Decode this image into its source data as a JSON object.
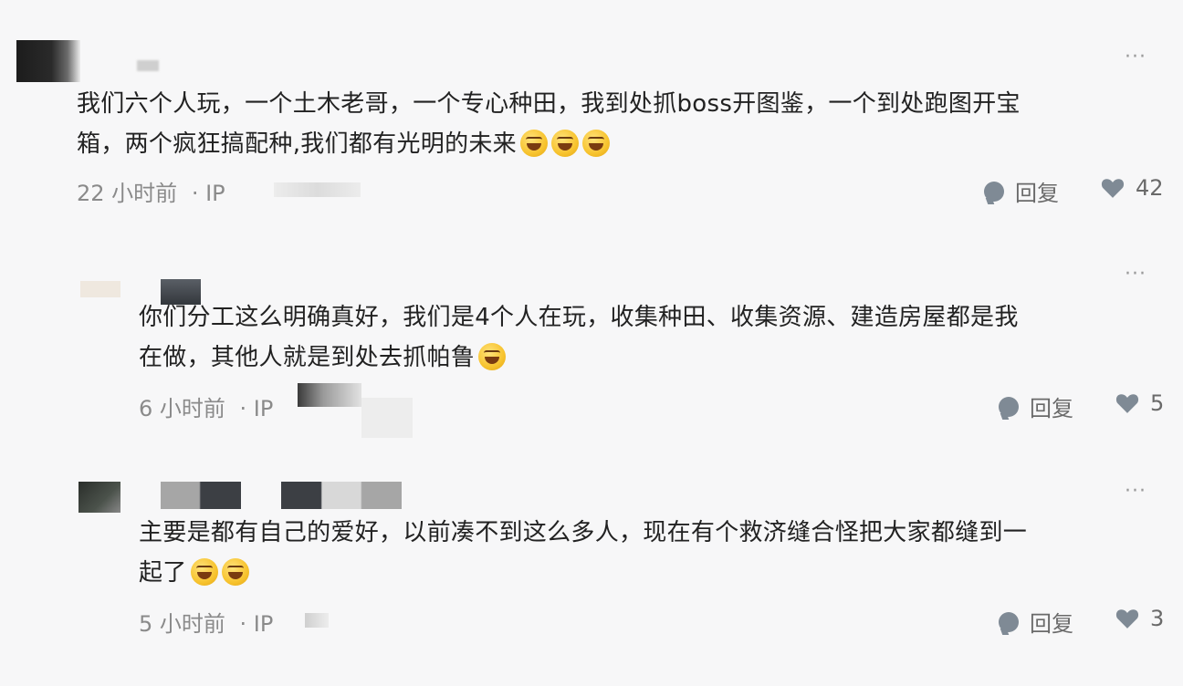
{
  "comments": [
    {
      "text_line1": "我们六个人玩，一个土木老哥，一个专心种田，我到处抓boss开图鉴，一个到处跑图开宝",
      "text_line2": "箱，两个疯狂搞配种,我们都有光明的未来",
      "time": "22 小时前",
      "ip_label": "· IP",
      "reply_label": "回复",
      "likes": "42",
      "more": "···"
    },
    {
      "text_line1": "你们分工这么明确真好，我们是4个人在玩，收集种田、收集资源、建造房屋都是我",
      "text_line2": "在做，其他人就是到处去抓帕鲁",
      "time": "6 小时前",
      "ip_label": "· IP",
      "reply_label": "回复",
      "likes": "5",
      "more": "···"
    },
    {
      "text_line1": "主要是都有自己的爱好，以前凑不到这么多人，现在有个救济缝合怪把大家都缝到一",
      "text_line2": "起了",
      "time": "5 小时前",
      "ip_label": "· IP",
      "reply_label": "回复",
      "likes": "3",
      "more": "···"
    }
  ],
  "icons": {
    "reply": "comment-bubble-icon",
    "like": "heart-icon",
    "more": "more-dots-icon",
    "emoji": "rofl-emoji"
  },
  "colors": {
    "background": "#f7f7f8",
    "text": "#222222",
    "meta": "#8a8a8a",
    "icon": "#7f8a95"
  }
}
